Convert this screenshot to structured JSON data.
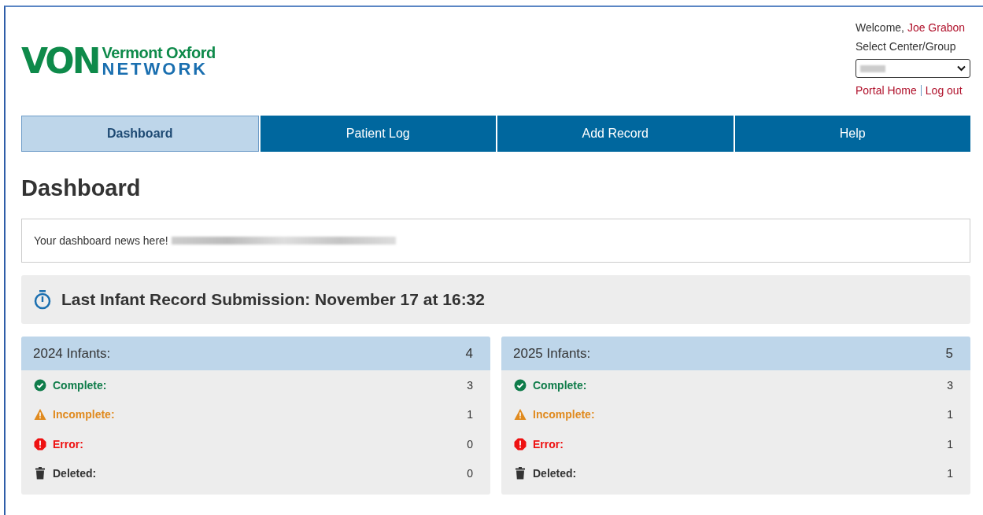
{
  "logo": {
    "mark": "VON",
    "line1": "Vermont Oxford",
    "line2": "NETWORK"
  },
  "user_panel": {
    "welcome": "Welcome,",
    "user_name": "Joe Grabon",
    "select_label": "Select Center/Group",
    "links": [
      "Portal Home",
      "Log out"
    ]
  },
  "tabs": [
    {
      "label": "Dashboard",
      "selected": true
    },
    {
      "label": "Patient Log",
      "selected": false
    },
    {
      "label": "Add Record",
      "selected": false
    },
    {
      "label": "Help",
      "selected": false
    }
  ],
  "page_title": "Dashboard",
  "news": {
    "text": "Your dashboard news here!"
  },
  "last_submission": "Last Infant Record Submission: November 17 at 16:32",
  "cards": [
    {
      "title": "2024 Infants:",
      "total": "4",
      "statuses": [
        {
          "kind": "complete",
          "label": "Complete:",
          "count": "3",
          "color": "#0f7c4a"
        },
        {
          "kind": "incomplete",
          "label": "Incomplete:",
          "count": "1",
          "color": "#e08a1e"
        },
        {
          "kind": "error",
          "label": "Error:",
          "count": "0",
          "color": "#ee1111"
        },
        {
          "kind": "deleted",
          "label": "Deleted:",
          "count": "0",
          "color": "#333333"
        }
      ]
    },
    {
      "title": "2025 Infants:",
      "total": "5",
      "statuses": [
        {
          "kind": "complete",
          "label": "Complete:",
          "count": "3",
          "color": "#0f7c4a"
        },
        {
          "kind": "incomplete",
          "label": "Incomplete:",
          "count": "1",
          "color": "#e08a1e"
        },
        {
          "kind": "error",
          "label": "Error:",
          "count": "1",
          "color": "#ee1111"
        },
        {
          "kind": "deleted",
          "label": "Deleted:",
          "count": "1",
          "color": "#333333"
        }
      ]
    }
  ]
}
